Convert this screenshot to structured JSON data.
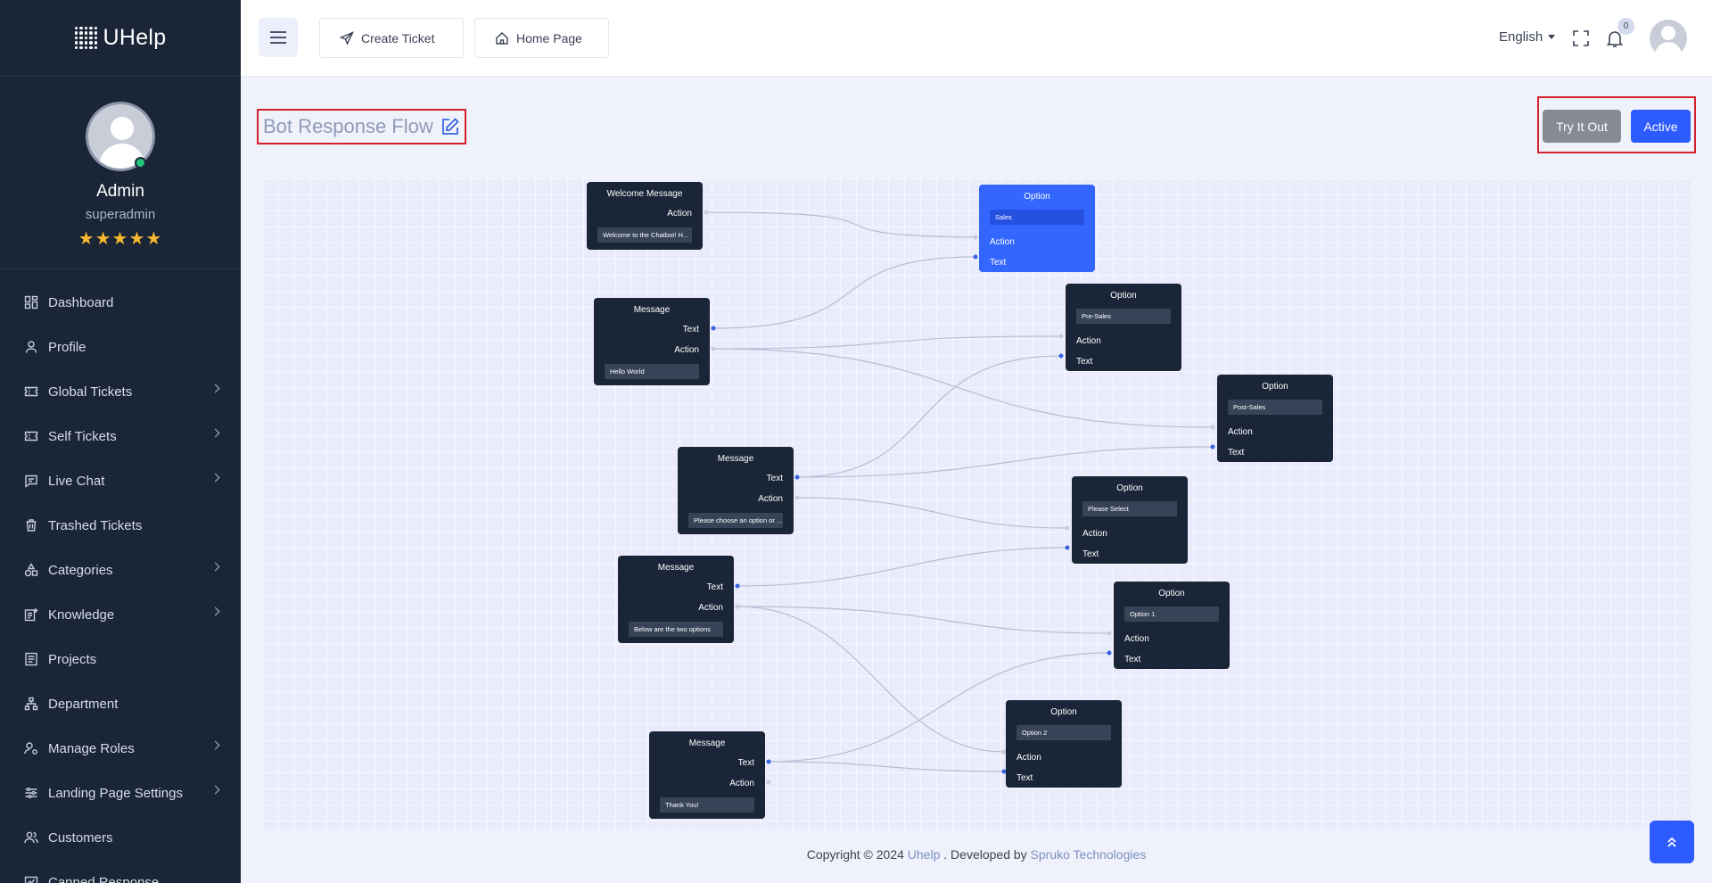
{
  "brand": {
    "name": "UHelp"
  },
  "profile": {
    "name": "Admin",
    "role": "superadmin",
    "stars": "★★★★★"
  },
  "sidebar": {
    "items": [
      {
        "label": "Dashboard",
        "icon": "dashboard-icon",
        "has_sub": false
      },
      {
        "label": "Profile",
        "icon": "user-icon",
        "has_sub": false
      },
      {
        "label": "Global Tickets",
        "icon": "ticket-icon",
        "has_sub": true
      },
      {
        "label": "Self Tickets",
        "icon": "ticket-icon",
        "has_sub": true
      },
      {
        "label": "Live Chat",
        "icon": "chat-icon",
        "has_sub": true
      },
      {
        "label": "Trashed Tickets",
        "icon": "trash-icon",
        "has_sub": false
      },
      {
        "label": "Categories",
        "icon": "category-icon",
        "has_sub": true
      },
      {
        "label": "Knowledge",
        "icon": "knowledge-icon",
        "has_sub": true
      },
      {
        "label": "Projects",
        "icon": "projects-icon",
        "has_sub": false
      },
      {
        "label": "Department",
        "icon": "department-icon",
        "has_sub": false
      },
      {
        "label": "Manage Roles",
        "icon": "roles-icon",
        "has_sub": true
      },
      {
        "label": "Landing Page Settings",
        "icon": "settings-icon",
        "has_sub": true
      },
      {
        "label": "Customers",
        "icon": "customers-icon",
        "has_sub": false
      },
      {
        "label": "Canned Response",
        "icon": "canned-icon",
        "has_sub": false
      }
    ]
  },
  "header": {
    "create_ticket": "Create Ticket",
    "home_page": "Home Page",
    "language": "English",
    "notification_count": "0"
  },
  "main": {
    "title": "Bot Response Flow",
    "try_label": "Try It Out",
    "active_label": "Active"
  },
  "flow": {
    "nodes": [
      {
        "id": "n1",
        "title": "Welcome Message",
        "kind": "message",
        "rows": [
          "Action"
        ],
        "field": "Welcome to the Chatbot! H..."
      },
      {
        "id": "n2",
        "title": "Message",
        "kind": "message",
        "rows": [
          "Text",
          "Action"
        ],
        "field": "Hello World"
      },
      {
        "id": "n3",
        "title": "Message",
        "kind": "message",
        "rows": [
          "Text",
          "Action"
        ],
        "field": "Please choose an option or ..."
      },
      {
        "id": "n4",
        "title": "Message",
        "kind": "message",
        "rows": [
          "Text",
          "Action"
        ],
        "field": "Below are the two options"
      },
      {
        "id": "n5",
        "title": "Message",
        "kind": "message",
        "rows": [
          "Text",
          "Action"
        ],
        "field": "Thank You!"
      },
      {
        "id": "o1",
        "title": "Option",
        "kind": "option",
        "field": "Sales",
        "rows": [
          "Action",
          "Text"
        ],
        "highlight": true
      },
      {
        "id": "o2",
        "title": "Option",
        "kind": "option",
        "field": "Pre-Sales",
        "rows": [
          "Action",
          "Text"
        ]
      },
      {
        "id": "o3",
        "title": "Option",
        "kind": "option",
        "field": "Post-Sales",
        "rows": [
          "Action",
          "Text"
        ]
      },
      {
        "id": "o4",
        "title": "Option",
        "kind": "option",
        "field": "Please Select",
        "rows": [
          "Action",
          "Text"
        ]
      },
      {
        "id": "o5",
        "title": "Option",
        "kind": "option",
        "field": "Option 1",
        "rows": [
          "Action",
          "Text"
        ]
      },
      {
        "id": "o6",
        "title": "Option",
        "kind": "option",
        "field": "Option 2",
        "rows": [
          "Action",
          "Text"
        ]
      }
    ]
  },
  "footer": {
    "prefix": "Copyright © 2024 ",
    "brand": "Uhelp",
    "middle": " . Developed by ",
    "dev": "Spruko Technologies"
  },
  "colors": {
    "sidebar": "#1a2538",
    "accent": "#2d5bff",
    "highlight_box": "#d5202c"
  }
}
